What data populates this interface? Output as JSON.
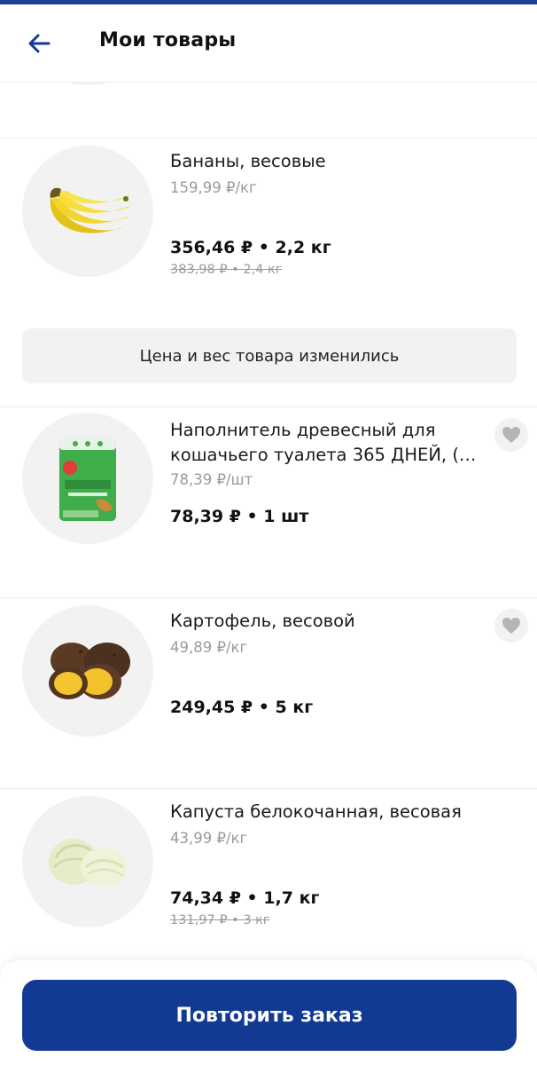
{
  "header": {
    "title": "Мои товары",
    "back_icon": "arrow-left-icon"
  },
  "colors": {
    "brand": "#123a93",
    "muted_text": "#9a9a9a",
    "surface": "#f2f2f2"
  },
  "items": [
    {
      "name": "Бананы, весовые",
      "unit_price": "159,99 ₽/кг",
      "total": "356,46 ₽ • 2,2 кг",
      "old_total": "383,98 ₽ • 2,4 кг",
      "image": "banana-icon"
    },
    {
      "name": "Наполнитель древесный для кошачьего туалета 365 ДНЕЙ, (…",
      "unit_price": "78,39 ₽/шт",
      "total": "78,39 ₽ • 1 шт",
      "image": "litter-bag-icon",
      "brand_badge": "365",
      "favorite_icon": "heart-icon"
    },
    {
      "name": "Картофель, весовой",
      "unit_price": "49,89 ₽/кг",
      "total": "249,45 ₽ • 5 кг",
      "image": "potato-icon",
      "favorite_icon": "heart-icon"
    },
    {
      "name": "Капуста белокочанная, весовая",
      "unit_price": "43,99 ₽/кг",
      "total": "74,34 ₽ • 1,7 кг",
      "old_total": "131,97 ₽ • 3 кг",
      "image": "cabbage-icon"
    }
  ],
  "notice": "Цена и вес товара изменились",
  "actions": {
    "repeat_order": "Повторить заказ"
  }
}
